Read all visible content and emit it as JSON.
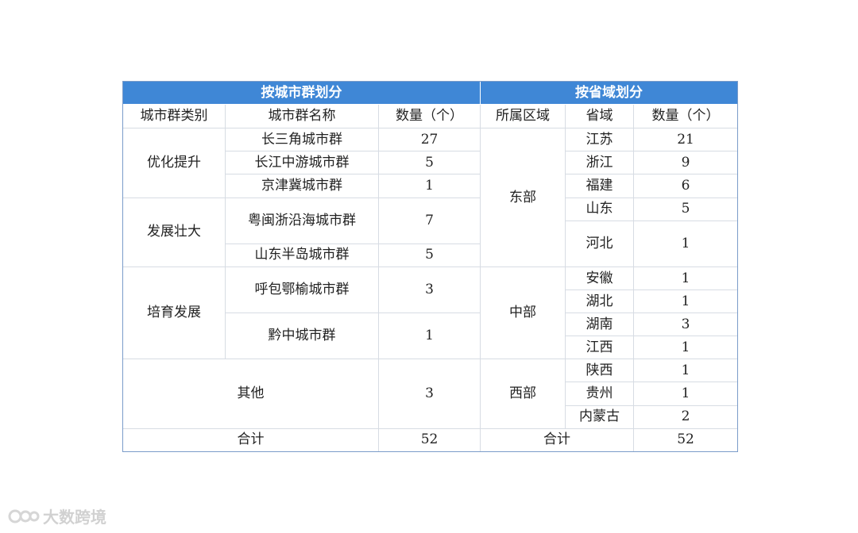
{
  "header": {
    "left_title": "按城市群划分",
    "right_title": "按省域划分"
  },
  "columns": {
    "category": "城市群类别",
    "cluster_name": "城市群名称",
    "count_left": "数量（个）",
    "region": "所属区域",
    "province": "省域",
    "count_right": "数量（个）"
  },
  "left": {
    "groups": [
      {
        "category": "优化提升",
        "rows": [
          {
            "name": "长三角城市群",
            "count": "27"
          },
          {
            "name": "长江中游城市群",
            "count": "5"
          },
          {
            "name": "京津冀城市群",
            "count": "1"
          }
        ]
      },
      {
        "category": "发展壮大",
        "rows": [
          {
            "name": "粤闽浙沿海城市群",
            "count": "7"
          },
          {
            "name": "山东半岛城市群",
            "count": "5"
          }
        ]
      },
      {
        "category": "培育发展",
        "rows": [
          {
            "name": "呼包鄂榆城市群",
            "count": "3"
          },
          {
            "name": "黔中城市群",
            "count": "1"
          }
        ]
      }
    ],
    "other": {
      "label": "其他",
      "count": "3"
    },
    "total": {
      "label": "合计",
      "count": "52"
    }
  },
  "right": {
    "regions": [
      {
        "name": "东部",
        "rows": [
          {
            "province": "江苏",
            "count": "21"
          },
          {
            "province": "浙江",
            "count": "9"
          },
          {
            "province": "福建",
            "count": "6"
          },
          {
            "province": "山东",
            "count": "5"
          },
          {
            "province": "河北",
            "count": "1"
          }
        ]
      },
      {
        "name": "中部",
        "rows": [
          {
            "province": "安徽",
            "count": "1"
          },
          {
            "province": "湖北",
            "count": "1"
          },
          {
            "province": "湖南",
            "count": "3"
          },
          {
            "province": "江西",
            "count": "1"
          }
        ]
      },
      {
        "name": "西部",
        "rows": [
          {
            "province": "陕西",
            "count": "1"
          },
          {
            "province": "贵州",
            "count": "1"
          },
          {
            "province": "内蒙古",
            "count": "2"
          }
        ]
      }
    ],
    "total": {
      "label": "合计",
      "count": "52"
    }
  },
  "watermark": {
    "text": "大数跨境",
    "icon": "brand-logo-icon"
  },
  "colors": {
    "header_bg": "#3f87d6",
    "header_text": "#ffffff",
    "grid": "#d7dce3"
  }
}
